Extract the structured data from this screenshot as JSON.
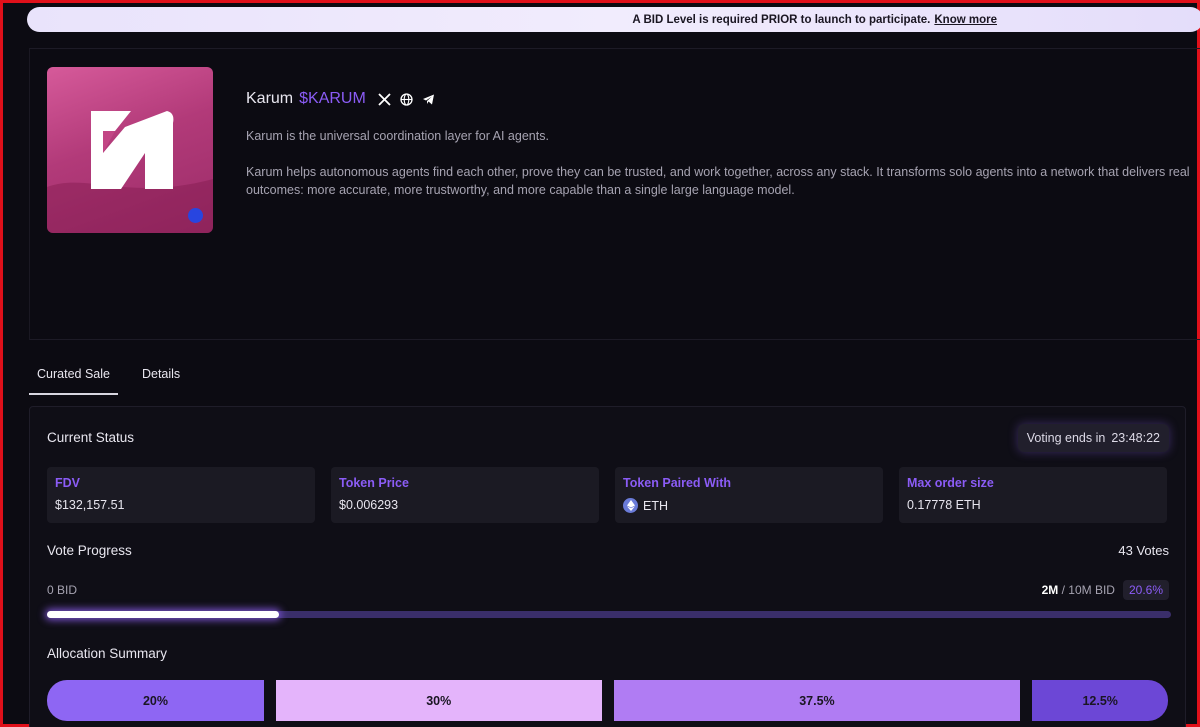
{
  "banner": {
    "text": "A BID Level is required PRIOR to launch to participate.",
    "link": "Know more"
  },
  "project": {
    "name": "Karum",
    "ticker": "$KARUM",
    "social_icons": [
      "x-icon",
      "globe-icon",
      "telegram-icon"
    ],
    "description_1": "Karum is the universal coordination layer for AI agents.",
    "description_2": "Karum helps autonomous agents find each other, prove they can be trusted, and work together, across any stack. It transforms solo agents into a network that delivers real outcomes: more accurate, more trustworthy, and more capable than a single large language model."
  },
  "tabs": [
    {
      "label": "Curated Sale",
      "active": true
    },
    {
      "label": "Details",
      "active": false
    }
  ],
  "status": {
    "title": "Current Status",
    "voting_label": "Voting ends in",
    "voting_time": "23:48:22",
    "stats": [
      {
        "label": "FDV",
        "value": "$132,157.51"
      },
      {
        "label": "Token Price",
        "value": "$0.006293"
      },
      {
        "label": "Token Paired With",
        "value": "ETH"
      },
      {
        "label": "Max order size",
        "value": "0.17778 ETH"
      }
    ]
  },
  "vote_progress": {
    "title": "Vote Progress",
    "votes": "43 Votes",
    "min_label": "0 BID",
    "current": "2M",
    "target": "/ 10M BID",
    "percent_label": "20.6%",
    "fraction": 0.206
  },
  "allocation": {
    "title": "Allocation Summary",
    "segments": [
      {
        "label": "20%",
        "share": 20
      },
      {
        "label": "30%",
        "share": 30
      },
      {
        "label": "37.5%",
        "share": 37.5
      },
      {
        "label": "12.5%",
        "share": 12.5
      }
    ]
  },
  "colors": {
    "accent": "#8b5cf6",
    "banner_bg": "#ece6fc",
    "border_frame": "#e0101a"
  }
}
